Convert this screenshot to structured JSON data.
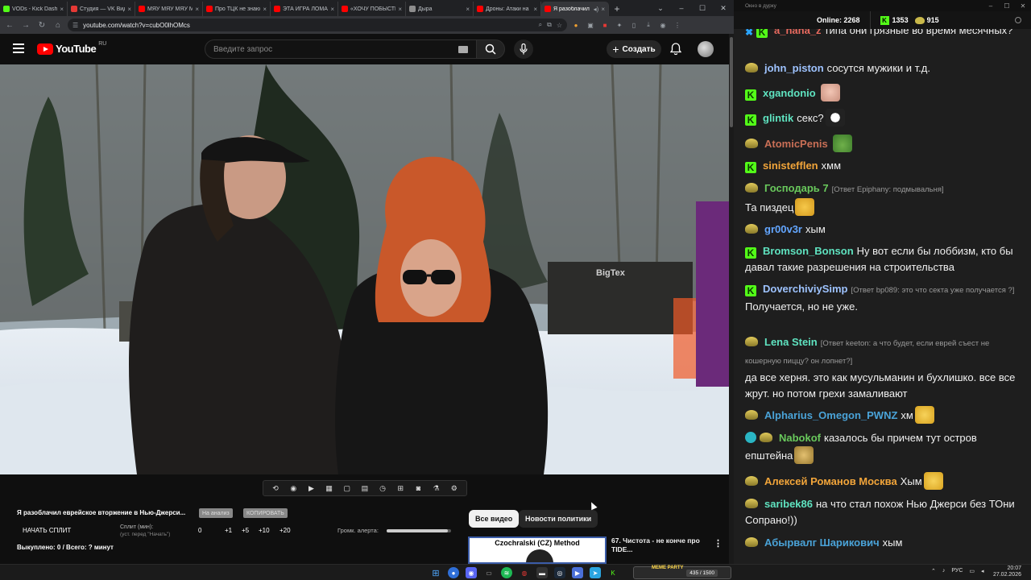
{
  "browser": {
    "tabs": [
      {
        "label": "VODs - Kick Dashb",
        "color": "#53fc18"
      },
      {
        "label": "Студия — VK Видео",
        "color": "#e53935"
      },
      {
        "label": "МЯУ МЯУ МЯУ МЯУ",
        "color": "#ff0000"
      },
      {
        "label": "Про ТЦК не знают",
        "color": "#ff0000"
      },
      {
        "label": "ЭТА ИГРА ЛОМАЕТ",
        "color": "#ff0000"
      },
      {
        "label": "«ХОЧУ ПОБЫСТРЕ",
        "color": "#ff0000"
      },
      {
        "label": "Дыра",
        "color": "#8d8d8d"
      },
      {
        "label": "Дроны: Атаки на Б",
        "color": "#ff0000"
      },
      {
        "label": "Я разоблачил",
        "color": "#ff0000"
      }
    ],
    "url": "youtube.com/watch?v=cubO0lhOMcs"
  },
  "youtube": {
    "logo_text": "YouTube",
    "region": "RU",
    "search_placeholder": "Введите запрос",
    "create_label": "Создать"
  },
  "below_video": {
    "title": "Я разоблачил еврейское вторжение в Нью-Джерси...",
    "chip1": "На анализ",
    "chip2": "КОПИРОВАТЬ",
    "start_split": "НАЧАТЬ СПЛИТ",
    "split_label": "Сплит (мин):",
    "split_sub": "(уст. перед \"Начать\")",
    "split_values": [
      "0",
      "+1",
      "+5",
      "+10",
      "+20"
    ],
    "alert_label": "Громк. алерта:",
    "alert_volume": 0.95,
    "bought": "Выкуплено: 0 / Всего: ? минут"
  },
  "recommendations": {
    "pills": [
      "Все видео",
      "Новости политики"
    ],
    "first": {
      "thumb_text": "Czochralski (CZ) Method",
      "title": "67. Чистота - не конче про TIDE..."
    }
  },
  "chat": {
    "window_title": "Окно в дурку",
    "online_label": "Online:",
    "online_count": "2268",
    "kick_count": "1353",
    "coin_count": "915",
    "messages": [
      {
        "badge": "kick",
        "user": "a_nana_z",
        "color": "#e86a5f",
        "text": "типа они грязные во время месячных?"
      },
      {
        "badge": "meme",
        "user": "john_piston",
        "color": "#9ec3ff",
        "text": "сосутся мужики и т.д."
      },
      {
        "badge": "kick",
        "user": "xgandonio",
        "color": "#5fe3c0",
        "text": ""
      },
      {
        "badge": "kick",
        "user": "glintik",
        "color": "#5fe3c0",
        "text": "секс?"
      },
      {
        "badge": "meme",
        "user": "AtomicPenis",
        "color": "#c96f56",
        "text": ""
      },
      {
        "badge": "kick",
        "user": "sinistefflen",
        "color": "#f2a53a",
        "text": "хмм"
      },
      {
        "badge": "meme",
        "user": "Господарь 7",
        "color": "#69c95c",
        "reply": "[Ответ Epiphany: подмывальня]",
        "text": "Та пиздец"
      },
      {
        "badge": "meme",
        "user": "gr00v3r",
        "color": "#63a6ff",
        "text": "хым"
      },
      {
        "badge": "kick",
        "user": "Bromson_Bonson",
        "color": "#5fe3c0",
        "text": "Ну вот если бы лоббизм, кто бы давал такие разрешения на строительства"
      },
      {
        "badge": "kick",
        "user": "DoverchiviySimp",
        "color": "#9ec3ff",
        "reply": "[Ответ bp089: это что секта уже получается ?]",
        "text": "Получается, но не уже."
      },
      {
        "badge": "meme",
        "user": "Lena Stein",
        "color": "#5fe3c0",
        "reply": "[Ответ keeton: а что будет, если еврей съест не кошерную пиццу? он лопнет?]",
        "text": "да все херня. это как мусульманин и бухлишко. все все жрут. но потом грехи замаливают"
      },
      {
        "badge": "meme",
        "user": "Alpharius_Omegon_PWNZ",
        "color": "#4aa3d8",
        "text": "хм"
      },
      {
        "badge": "vip",
        "user": "Nabokof",
        "color": "#69c95c",
        "text": "казалось бы причем тут остров епштейна"
      },
      {
        "badge": "meme",
        "user": "Алексей Романов Москва",
        "color": "#f2a53a",
        "text": "Хым"
      },
      {
        "badge": "meme",
        "user": "saribek86",
        "color": "#5fe3c0",
        "text": "на что стал похож Нью Джерси без ТОни Сопрано!))"
      },
      {
        "badge": "meme",
        "user": "Абырвалг Шарикович",
        "color": "#4aa3d8",
        "text": "хым"
      }
    ]
  },
  "taskbar": {
    "meme_party_label": "MEME PARTY",
    "meme_party_count": "435 / 1500",
    "lang": "РУС",
    "time": "20:07",
    "date": "27.02.2026"
  }
}
